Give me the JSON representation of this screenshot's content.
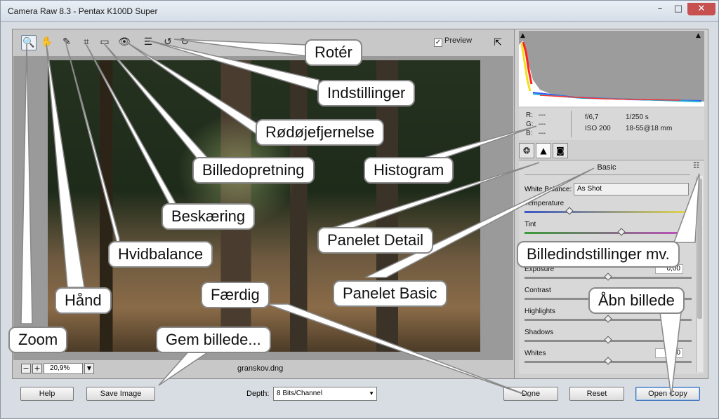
{
  "window": {
    "title": "Camera Raw 8.3  -  Pentax K100D Super",
    "controls": {
      "minimize": "–",
      "maximize": "□",
      "close": "✕"
    }
  },
  "toolbar": {
    "tools": [
      {
        "name": "zoom-tool",
        "icon": "magnifier-icon",
        "glyph": "🔍"
      },
      {
        "name": "hand-tool",
        "icon": "hand-icon",
        "glyph": "✋"
      },
      {
        "name": "white-balance-tool",
        "icon": "eyedropper-icon",
        "glyph": "✎"
      },
      {
        "name": "crop-tool",
        "icon": "crop-icon",
        "glyph": "⌗"
      },
      {
        "name": "straighten-tool",
        "icon": "level-icon",
        "glyph": "▭"
      },
      {
        "name": "red-eye-tool",
        "icon": "eye-icon",
        "glyph": "👁"
      },
      {
        "name": "preferences-tool",
        "icon": "list-icon",
        "glyph": "☰"
      },
      {
        "name": "rotate-left-tool",
        "icon": "rotate-ccw-icon",
        "glyph": "↺"
      },
      {
        "name": "rotate-right-tool",
        "icon": "rotate-cw-icon",
        "glyph": "↻"
      }
    ],
    "preview_label": "Preview",
    "preview_checked": true
  },
  "status": {
    "zoom_value": "20,9%",
    "filename": "granskov.dng"
  },
  "readout": {
    "r": "---",
    "g": "---",
    "b": "---",
    "aperture": "f/6,7",
    "shutter": "1/250 s",
    "iso": "ISO 200",
    "lens": "18-55@18 mm"
  },
  "panel": {
    "title": "Basic",
    "white_balance_label": "White Balance:",
    "white_balance_value": "As Shot",
    "sliders": [
      {
        "label": "Temperature",
        "value": "",
        "position": 0.27,
        "track": "temp"
      },
      {
        "label": "Tint",
        "value": "",
        "position": 0.58,
        "track": "tint"
      },
      {
        "label": "Exposure",
        "value": "0,00",
        "position": 0.5,
        "track": ""
      },
      {
        "label": "Contrast",
        "value": "",
        "position": 0.5,
        "track": ""
      },
      {
        "label": "Highlights",
        "value": "",
        "position": 0.5,
        "track": ""
      },
      {
        "label": "Shadows",
        "value": "",
        "position": 0.5,
        "track": ""
      },
      {
        "label": "Whites",
        "value": "0",
        "position": 0.5,
        "track": ""
      }
    ]
  },
  "bottombar": {
    "help": "Help",
    "save_image": "Save Image",
    "depth_label": "Depth:",
    "depth_value": "8 Bits/Channel",
    "done": "Done",
    "reset": "Reset",
    "open_copy": "Open Copy"
  },
  "callouts": {
    "roter": "Rotér",
    "indstillinger": "Indstillinger",
    "rodojefjernelse": "Rødøjefjernelse",
    "billedopretning": "Billedopretning",
    "histogram": "Histogram",
    "beskaering": "Beskæring",
    "panelet_detail": "Panelet Detail",
    "billedindstillinger": "Billedindstillinger mv.",
    "hvidbalance": "Hvidbalance",
    "panelet_basic": "Panelet Basic",
    "faerdig": "Færdig",
    "abn_billede": "Åbn billede",
    "hand": "Hånd",
    "gem_billede": "Gem billede...",
    "zoom": "Zoom"
  },
  "colors": {
    "callout_border": "#888888",
    "pointer_fill": "#ffffff",
    "default_button_border": "#3a6fb7"
  }
}
